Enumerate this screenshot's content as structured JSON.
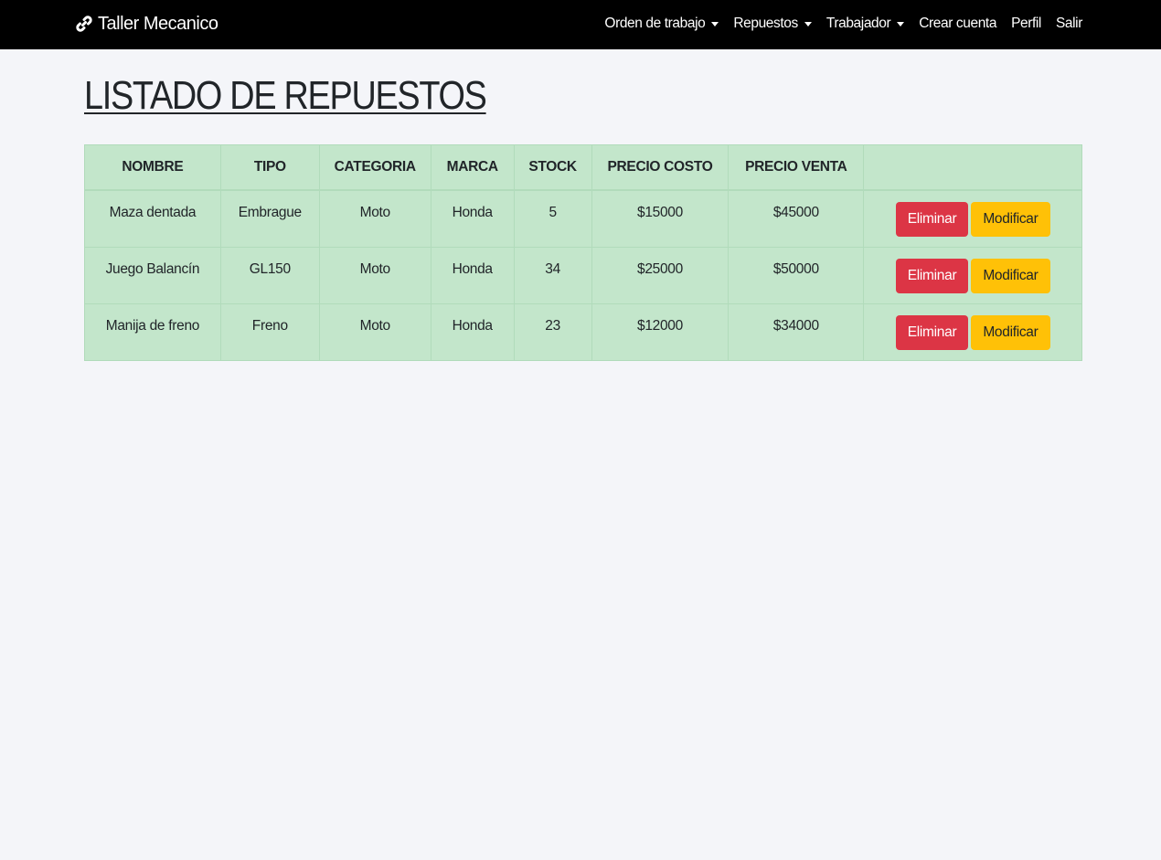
{
  "navbar": {
    "brand": "Taller Mecanico",
    "items": [
      {
        "label": "Orden de trabajo",
        "dropdown": true
      },
      {
        "label": "Repuestos",
        "dropdown": true
      },
      {
        "label": "Trabajador",
        "dropdown": true
      },
      {
        "label": "Crear cuenta",
        "dropdown": false
      },
      {
        "label": "Perfil",
        "dropdown": false
      },
      {
        "label": "Salir",
        "dropdown": false
      }
    ]
  },
  "page": {
    "title": "LISTADO DE REPUESTOS"
  },
  "table": {
    "headers": [
      "NOMBRE",
      "TIPO",
      "CATEGORIA",
      "MARCA",
      "STOCK",
      "PRECIO COSTO",
      "PRECIO VENTA",
      ""
    ],
    "rows": [
      {
        "nombre": "Maza dentada",
        "tipo": "Embrague",
        "categoria": "Moto",
        "marca": "Honda",
        "stock": "5",
        "precio_costo": "$15000",
        "precio_venta": "$45000"
      },
      {
        "nombre": "Juego Balancín",
        "tipo": "GL150",
        "categoria": "Moto",
        "marca": "Honda",
        "stock": "34",
        "precio_costo": "$25000",
        "precio_venta": "$50000"
      },
      {
        "nombre": "Manija de freno",
        "tipo": "Freno",
        "categoria": "Moto",
        "marca": "Honda",
        "stock": "23",
        "precio_costo": "$12000",
        "precio_venta": "$34000"
      }
    ],
    "actions": {
      "delete_label": "Eliminar",
      "edit_label": "Modificar"
    }
  },
  "colors": {
    "navbar_bg": "#000000",
    "page_bg": "#f4f5f9",
    "table_bg": "#c3e6cb",
    "danger": "#dc3545",
    "warning": "#ffc107"
  }
}
